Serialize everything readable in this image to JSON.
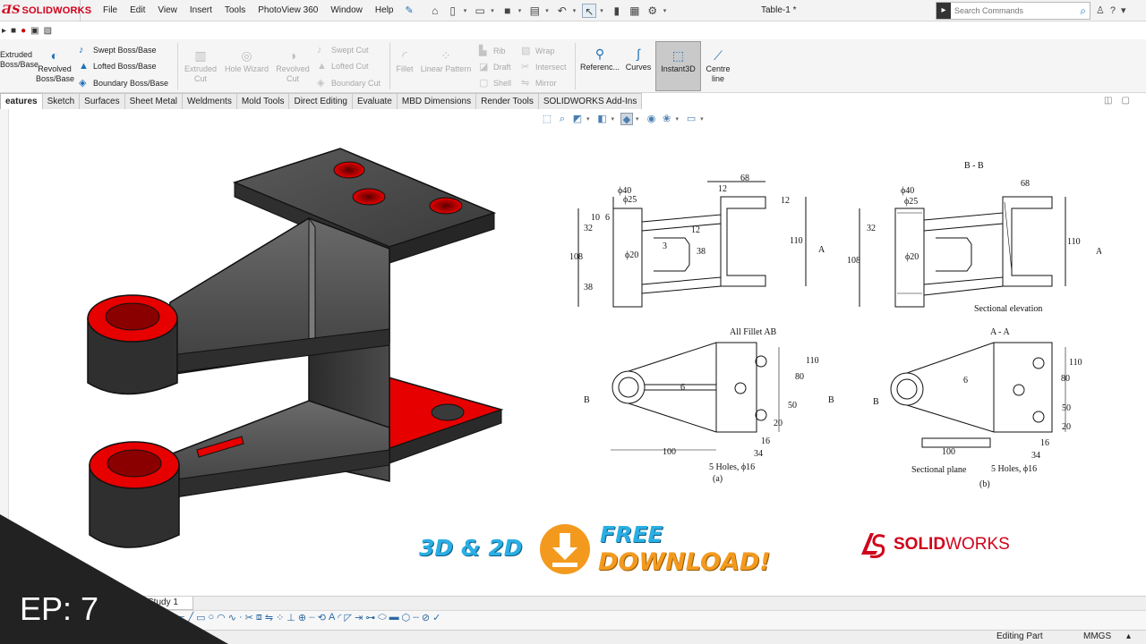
{
  "app": {
    "logo": "SOLIDWORKS",
    "document_title": "Table-1 *",
    "menu": [
      "File",
      "Edit",
      "View",
      "Insert",
      "Tools",
      "PhotoView 360",
      "Window",
      "Help"
    ],
    "search_placeholder": "Search Commands"
  },
  "commands": {
    "extruded_boss": [
      "Extruded",
      "Boss/Base"
    ],
    "revolved_boss": [
      "Revolved",
      "Boss/Base"
    ],
    "swept_boss": "Swept Boss/Base",
    "lofted_boss": "Lofted Boss/Base",
    "boundary_boss": "Boundary Boss/Base",
    "extruded_cut": [
      "Extruded",
      "Cut"
    ],
    "hole_wizard": "Hole Wizard",
    "revolved_cut": [
      "Revolved",
      "Cut"
    ],
    "swept_cut": "Swept Cut",
    "lofted_cut": "Lofted Cut",
    "boundary_cut": "Boundary Cut",
    "fillet": "Fillet",
    "linear_pattern": "Linear Pattern",
    "rib": "Rib",
    "draft": "Draft",
    "shell": "Shell",
    "wrap": "Wrap",
    "intersect": "Intersect",
    "mirror": "Mirror",
    "reference": "Referenc...",
    "curves": "Curves",
    "instant3d": "Instant3D",
    "centre_line": [
      "Centre",
      "line"
    ]
  },
  "tabs": [
    "eatures",
    "Sketch",
    "Surfaces",
    "Sheet Metal",
    "Weldments",
    "Mold Tools",
    "Direct Editing",
    "Evaluate",
    "MBD Dimensions",
    "Render Tools",
    "SOLIDWORKS Add-Ins"
  ],
  "drawing": {
    "section_bb": "B - B",
    "section_aa": "A - A",
    "sectional_elevation": "Sectional elevation",
    "all_fillet": "All Fillet AB",
    "sectional_plane": "Sectional plane",
    "holes": "5 Holes, ϕ16",
    "fig_a": "(a)",
    "fig_b": "(b)",
    "dims": {
      "d68": "68",
      "d12": "12",
      "d40": "ϕ40",
      "d25": "ϕ25",
      "d10": "10",
      "d6": "6",
      "d32": "32",
      "d108": "108",
      "d38": "38",
      "d20": "ϕ20",
      "d3": "3",
      "d110": "110",
      "d80": "80",
      "d50": "50",
      "d20b": "20",
      "d100": "100",
      "d16": "16",
      "d34": "34",
      "la": "A",
      "lb": "B"
    }
  },
  "promo": {
    "three_d_2d": "3D & 2D",
    "free": "FREE",
    "download": "DOWNLOAD!",
    "brand_bold": "SOLID",
    "brand_rest": "WORKS"
  },
  "bottom": {
    "study_tab": "Study 1",
    "status_mode": "Editing Part",
    "units": "MMGS"
  },
  "episode": "EP: 7"
}
